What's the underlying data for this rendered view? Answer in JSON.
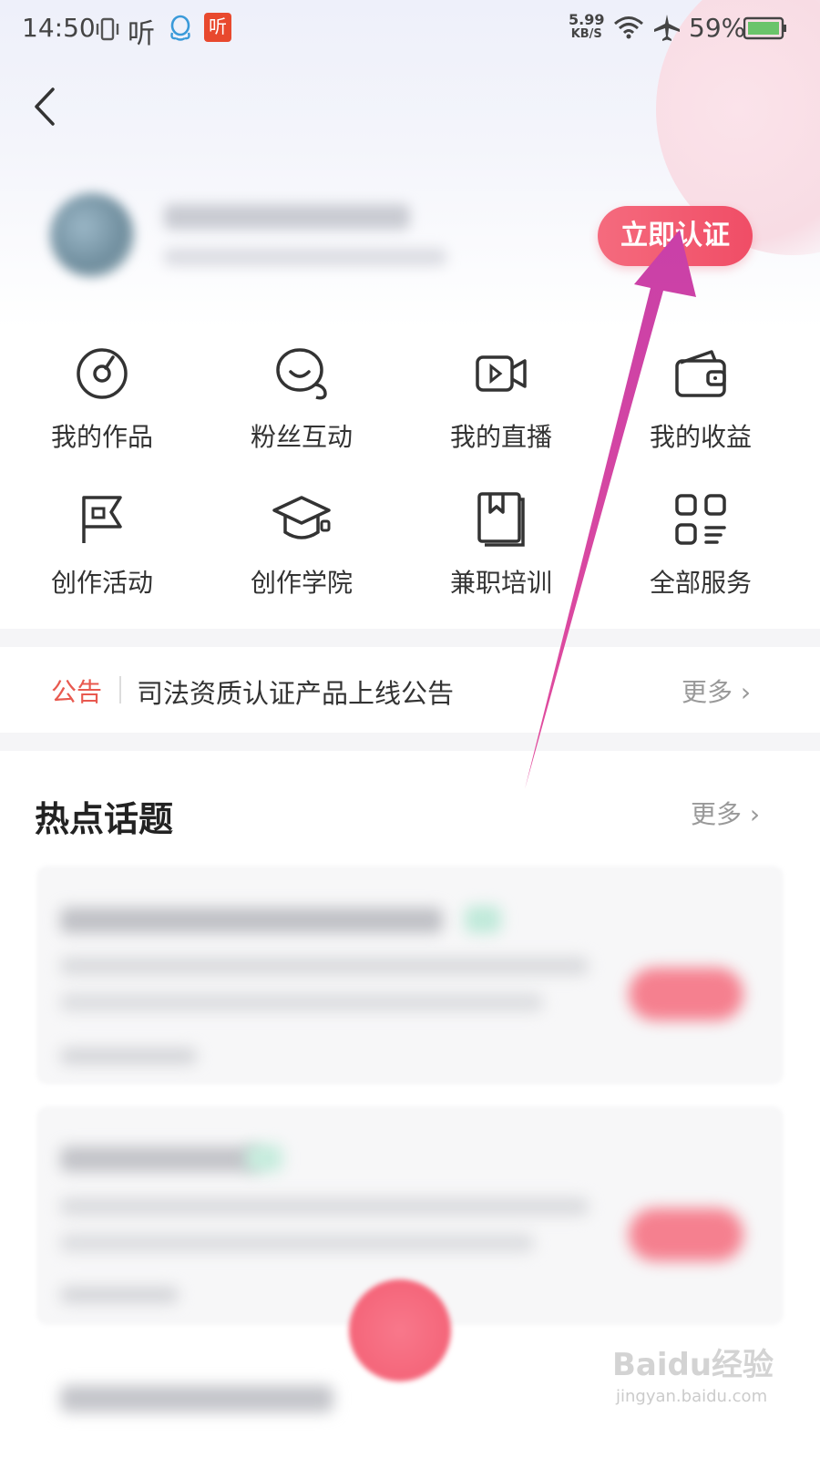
{
  "status_bar": {
    "time": "14:50",
    "net_speed": "5.99",
    "net_unit": "KB/S",
    "battery": "59%",
    "app_icon_label": "听"
  },
  "header": {
    "verify_button": "立即认证"
  },
  "services": [
    {
      "label": "我的作品",
      "icon": "disc-icon"
    },
    {
      "label": "粉丝互动",
      "icon": "chat-bubble-icon"
    },
    {
      "label": "我的直播",
      "icon": "video-camera-icon"
    },
    {
      "label": "我的收益",
      "icon": "wallet-icon"
    },
    {
      "label": "创作活动",
      "icon": "flag-icon"
    },
    {
      "label": "创作学院",
      "icon": "graduation-cap-icon"
    },
    {
      "label": "兼职培训",
      "icon": "book-icon"
    },
    {
      "label": "全部服务",
      "icon": "grid-apps-icon"
    }
  ],
  "notice": {
    "tag": "公告",
    "text": "司法资质认证产品上线公告",
    "more": "更多 ›"
  },
  "hot_topics": {
    "title": "热点话题",
    "more": "更多 ›"
  },
  "watermark": {
    "brand": "Baidu经验",
    "url": "jingyan.baidu.com"
  },
  "colors": {
    "accent": "#f04d66",
    "notice_tag": "#e8594f",
    "annotation_arrow": "#d63fa0"
  }
}
